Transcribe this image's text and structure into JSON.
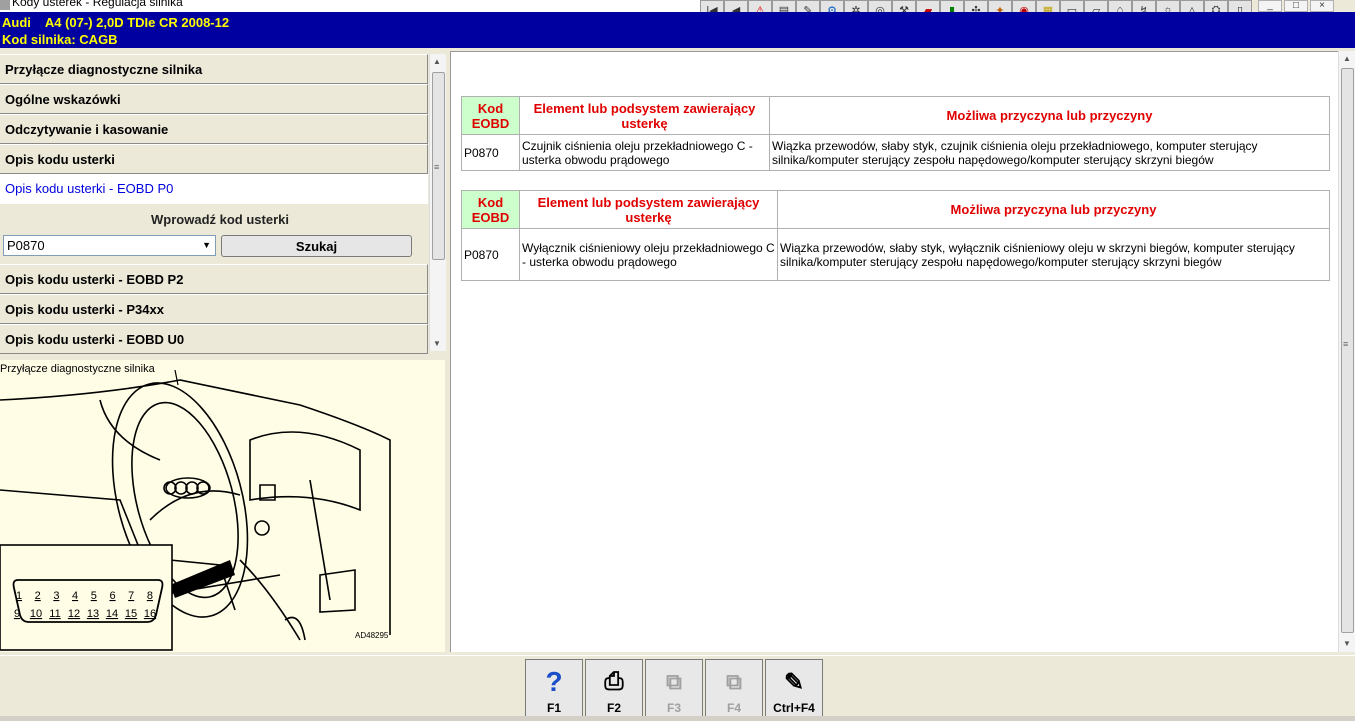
{
  "window": {
    "title": "Kody usterek - Regulacja silnika"
  },
  "vehicle": {
    "line1": "Audi    A4 (07-) 2,0D TDIe CR 2008-12",
    "line2": "Kod silnika: CAGB"
  },
  "toolbar": {
    "icons": [
      "first-icon",
      "prev-icon",
      "warning-icon",
      "document-icon",
      "tool-icon",
      "engine-icon",
      "gear-icon",
      "wheel-icon",
      "wrench-icon",
      "car-icon",
      "battery-icon",
      "parts-icon",
      "key-icon",
      "lights-icon",
      "dtc-icon",
      "blank-icon",
      "car-outline-icon",
      "car-lift-icon",
      "service-icon",
      "bulb-icon",
      "warning-outline-icon",
      "engine-outline-icon",
      "fuse-icon"
    ]
  },
  "sidebar": {
    "items_top": [
      {
        "label": "Przyłącze diagnostyczne silnika"
      },
      {
        "label": "Ogólne wskazówki"
      },
      {
        "label": "Odczytywanie i kasowanie"
      },
      {
        "label": "Opis kodu usterki"
      },
      {
        "label": "Opis kodu usterki - EOBD P0"
      }
    ],
    "enter_code_label": "Wprowadź kod usterki",
    "code_value": "P0870",
    "search_label": "Szukaj",
    "items_bottom": [
      {
        "label": "Opis kodu usterki - EOBD P2"
      },
      {
        "label": "Opis kodu usterki - P34xx"
      },
      {
        "label": "Opis kodu usterki - EOBD U0"
      }
    ]
  },
  "figure": {
    "caption": "Przyłącze diagnostyczne silnika",
    "pins_top": [
      "1",
      "2",
      "3",
      "4",
      "5",
      "6",
      "7",
      "8"
    ],
    "pins_bottom": [
      "9",
      "10",
      "11",
      "12",
      "13",
      "14",
      "15",
      "16"
    ],
    "ref": "AD48295"
  },
  "tables": [
    {
      "headers": [
        "Kod EOBD",
        "Element lub podsystem zawierający usterkę",
        "Możliwa przyczyna lub przyczyny"
      ],
      "row": [
        "P0870",
        "Czujnik ciśnienia oleju przekładniowego C - usterka obwodu prądowego",
        "Wiązka przewodów, słaby styk, czujnik ciśnienia oleju przekładniowego, komputer sterujący silnika/komputer sterujący zespołu napędowego/komputer sterujący skrzyni biegów"
      ]
    },
    {
      "headers": [
        "Kod EOBD",
        "Element lub podsystem zawierający usterkę",
        "Możliwa przyczyna lub przyczyny"
      ],
      "row": [
        "P0870",
        "Wyłącznik ciśnieniowy oleju przekładniowego C - usterka obwodu prądowego",
        "Wiązka przewodów, słaby styk, wyłącznik ciśnieniowy oleju w skrzyni biegów, komputer sterujący silnika/komputer sterujący zespołu napędowego/komputer sterujący skrzyni biegów"
      ]
    }
  ],
  "footer": {
    "buttons": [
      {
        "label": "F1",
        "icon": "help-icon",
        "enabled": true
      },
      {
        "label": "F2",
        "icon": "printer-icon",
        "enabled": true
      },
      {
        "label": "F3",
        "icon": "copy-icon",
        "enabled": false
      },
      {
        "label": "F4",
        "icon": "paste-icon",
        "enabled": false
      },
      {
        "label": "Ctrl+F4",
        "icon": "notes-icon",
        "enabled": true
      }
    ]
  },
  "colors": {
    "header_bg": "#0000a0",
    "header_text": "#ffff00",
    "table_header_text": "#e00000",
    "code_header_bg": "#ccffcc",
    "active_link": "#0000e0"
  }
}
